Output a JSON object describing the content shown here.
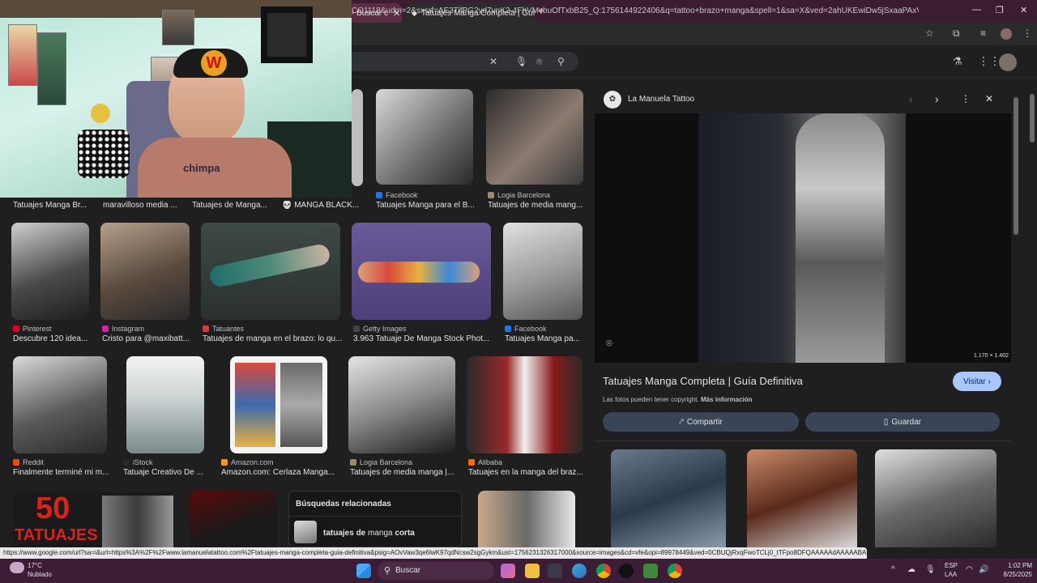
{
  "browser": {
    "tabs": [
      {
        "label": "- Buscar c",
        "active": false
      },
      {
        "label": "Tatuajes Manga Completa | Guí",
        "active": true
      }
    ],
    "url": "CO1118&udm=2&sxsrf=AE3TifPG2yd7vnK2-4FhVMvbuOfTxbB25_Q:1756144922406&q=tattoo+brazo+manga&spell=1&sa=X&ved=2ahUKEwiDw5jSxaaPAxVYRDABHW...",
    "status_url": "https://www.google.com/url?sa=i&url=https%3A%2F%2Fwww.lamanuelatattoo.com%2Ftatuajes-manga-completa-guia-definitiva&psig=AOvVaw3qe6lwK97qdNcsw2sgGykm&ust=1756231326317000&source=images&cd=vfe&opi=89978449&ved=0CBUQjRxqFwoTCLj0_tTFpo8DFQAAAAAdAAAAABAE"
  },
  "grid": {
    "row1": [
      {
        "caption": "Tatuajes Manga Br...",
        "source": ""
      },
      {
        "caption": "maravilloso media ...",
        "source": ""
      },
      {
        "caption": "Tatuajes de Manga...",
        "source": ""
      },
      {
        "caption": "💀 MANGA BLACK...",
        "source": ""
      },
      {
        "caption": "Tatuajes Manga para el B...",
        "source": "Facebook"
      },
      {
        "caption": "Tatuajes de media mang...",
        "source": "Logia Barcelona"
      }
    ],
    "row2": [
      {
        "caption": "Descubre 120 idea...",
        "source": "Pinterest"
      },
      {
        "caption": "Cristo para @maxibatt...",
        "source": "Instagram"
      },
      {
        "caption": "Tatuajes de manga en el brazo: lo qu...",
        "source": "Tatuantes"
      },
      {
        "caption": "3.963 Tatuaje De Manga Stock Phot...",
        "source": "Getty Images"
      },
      {
        "caption": "Tatuajes Manga pa...",
        "source": "Facebook"
      }
    ],
    "row3": [
      {
        "caption": "Finalmente terminé mi m...",
        "source": "Reddit"
      },
      {
        "caption": "Tatuaje Creativo De ...",
        "source": "iStock"
      },
      {
        "caption": "Amazon.com: Cerlaza Manga...",
        "source": "Amazon.com"
      },
      {
        "caption": "Tatuajes de media manga |...",
        "source": "Logia Barcelona"
      },
      {
        "caption": "Tatuajes en la manga del braz...",
        "source": "Alibaba"
      }
    ],
    "row4_text": {
      "big_number": "50",
      "big_word": "TATUAJES"
    }
  },
  "related": {
    "title": "Búsquedas relacionadas",
    "item_bold1": "tatuajes de",
    "item_normal": " manga ",
    "item_bold2": "corta"
  },
  "panel": {
    "site": "La Manuela Tattoo",
    "dimensions": "1.170 × 1.402",
    "title": "Tatuajes Manga Completa | Guía Definitiva",
    "visit": "Visitar",
    "copyright": "Las fotos pueden tener copyright.",
    "more_info": "Más información",
    "share": "Compartir",
    "save": "Guardar"
  },
  "taskbar": {
    "weather_temp": "17°C",
    "weather_desc": "Nublado",
    "search": "Buscar",
    "lang1": "ESP",
    "lang2": "LAA",
    "time": "1:02 PM",
    "date": "8/25/2025"
  },
  "webcam": {
    "shirt_text": "chimpa"
  },
  "colors": {
    "accent": "#a8c7fa",
    "tab_bar": "#3a1d2e",
    "taskbar": "#3b1d36"
  }
}
